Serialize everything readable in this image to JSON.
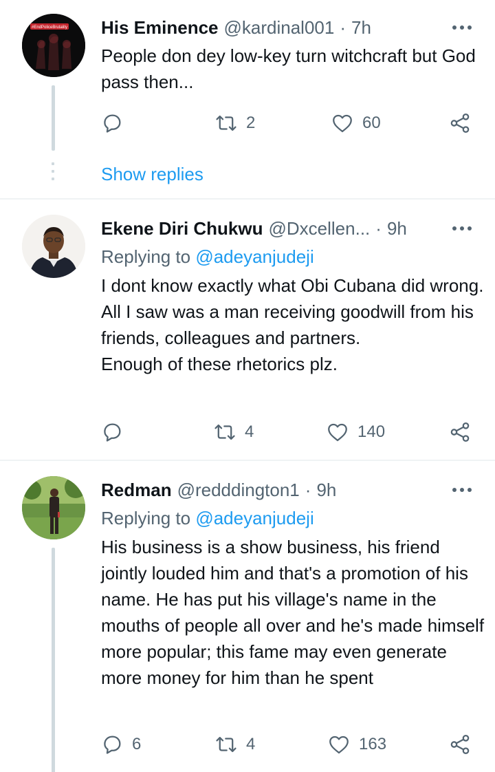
{
  "tweets": [
    {
      "name": "His Eminence",
      "handle": "@kardinal001",
      "time": "7h",
      "reply_to_label": "",
      "reply_to_handle": "",
      "text": "People don dey low-key turn witchcraft but God pass then...",
      "replies": "",
      "retweets": "2",
      "likes": "60",
      "avatar_badge": "#EndPoliceBrutality"
    },
    {
      "name": "Ekene Diri Chukwu",
      "handle": "@Dxcellen...",
      "time": "9h",
      "reply_to_label": "Replying to",
      "reply_to_handle": "@adeyanjudeji",
      "text": "I dont know exactly what Obi Cubana did wrong. All I saw was a man receiving goodwill from his friends, colleagues and partners.\nEnough of these rhetorics plz.",
      "replies": "",
      "retweets": "4",
      "likes": "140"
    },
    {
      "name": "Redman",
      "handle": "@redddington1",
      "time": "9h",
      "reply_to_label": "Replying to",
      "reply_to_handle": "@adeyanjudeji",
      "text": "His business is a show business, his friend jointly louded him and that's a promotion of his name. He has put his village's name in the mouths of people all over and he's made himself more popular; this fame may even generate more money for him than he spent",
      "replies": "6",
      "retweets": "4",
      "likes": "163"
    }
  ],
  "show_replies": "Show replies",
  "separator": "·",
  "icons": {
    "reply": "reply-icon",
    "retweet": "retweet-icon",
    "like": "like-icon",
    "share": "share-icon",
    "more": "more-icon"
  },
  "colors": {
    "link": "#1d9bf0",
    "secondary": "#536471",
    "text": "#0f1419",
    "divider": "#eff3f4",
    "thread": "#cfd9de"
  }
}
